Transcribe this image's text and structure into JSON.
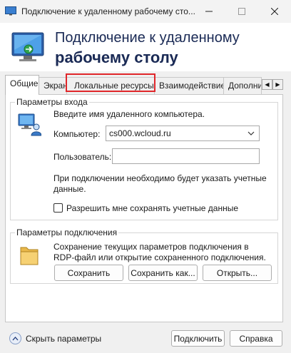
{
  "window": {
    "title": "Подключение к удаленному рабочему сто...",
    "minimize_icon": "minimize-icon",
    "maximize_icon": "maximize-icon",
    "close_icon": "close-icon"
  },
  "banner": {
    "line1": "Подключение к удаленному",
    "line2": "рабочему столу",
    "icon": "remote-desktop-icon"
  },
  "tabs": [
    {
      "label": "Общие",
      "active": true
    },
    {
      "label": "Экран",
      "active": false
    },
    {
      "label": "Локальные ресурсы",
      "active": false,
      "highlighted": true
    },
    {
      "label": "Взаимодействие",
      "active": false
    },
    {
      "label": "Дополнительно",
      "active": false
    }
  ],
  "tab_scroll": {
    "left": "◀",
    "right": "▶"
  },
  "logon": {
    "legend": "Параметры входа",
    "instruction": "Введите имя удаленного компьютера.",
    "computer_label": "Компьютер:",
    "computer_value": "cs000.wcloud.ru",
    "user_label": "Пользователь:",
    "user_value": "",
    "note_line1": "При подключении необходимо будет указать учетные",
    "note_line2": "данные.",
    "save_credentials_label": "Разрешить мне сохранять учетные данные",
    "save_credentials_checked": false
  },
  "connection": {
    "legend": "Параметры подключения",
    "desc_line1": "Сохранение текущих параметров подключения в",
    "desc_line2": "RDP-файл или открытие сохраненного подключения.",
    "save_label": "Сохранить",
    "save_as_label": "Сохранить как...",
    "open_label": "Открыть..."
  },
  "footer": {
    "hide_options_label": "Скрыть параметры",
    "connect_label": "Подключить",
    "help_label": "Справка"
  },
  "colors": {
    "accent": "#1a2a55",
    "highlight": "#e0262a"
  }
}
